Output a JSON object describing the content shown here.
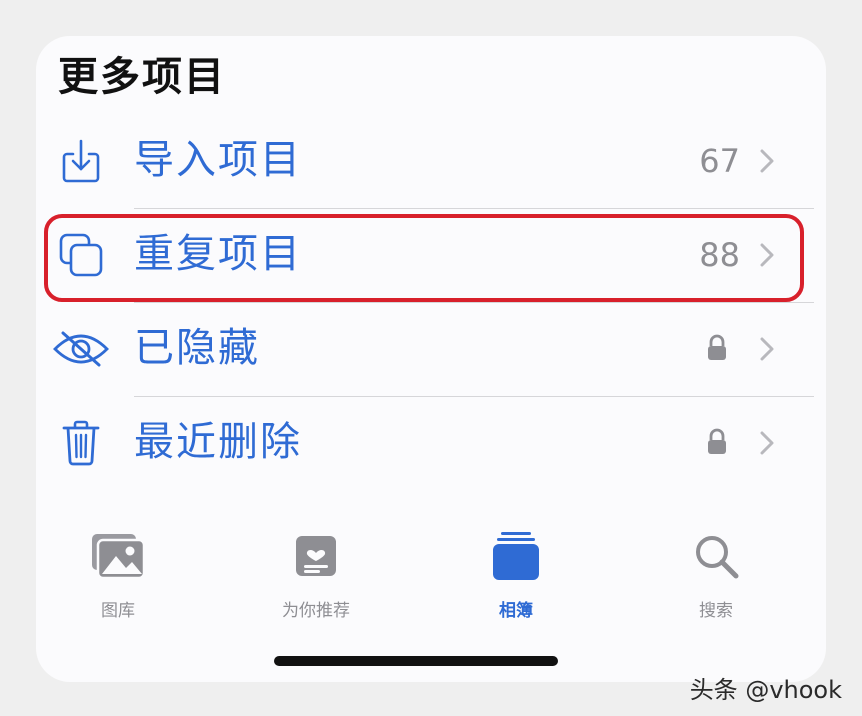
{
  "section": {
    "title": "更多项目"
  },
  "rows": [
    {
      "label": "导入项目",
      "count": "67",
      "icon": "import-icon"
    },
    {
      "label": "重复项目",
      "count": "88",
      "icon": "duplicate-icon"
    },
    {
      "label": "已隐藏",
      "count": "",
      "icon": "hidden-eye-icon",
      "locked": true
    },
    {
      "label": "最近删除",
      "count": "",
      "icon": "trash-icon",
      "locked": true
    }
  ],
  "tabs": [
    {
      "label": "图库",
      "icon": "photos-icon"
    },
    {
      "label": "为你推荐",
      "icon": "for-you-icon"
    },
    {
      "label": "相簿",
      "icon": "albums-icon",
      "active": true
    },
    {
      "label": "搜索",
      "icon": "search-icon"
    }
  ],
  "watermark": "头条 @vhook",
  "colors": {
    "accent": "#2f6bd4",
    "secondary_text": "#8e8e93",
    "highlight_border": "#d8202b"
  }
}
